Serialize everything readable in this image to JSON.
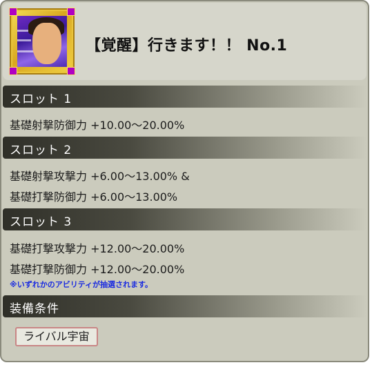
{
  "skill": {
    "title": "【覚醒】行きます！！ No.1",
    "portrait_icon": "character-portrait"
  },
  "sections": [
    {
      "label": "スロット 1",
      "lines": [
        "基礎射撃防御力 +10.00〜20.00%"
      ]
    },
    {
      "label": "スロット 2",
      "lines": [
        "基礎射撃攻撃力 +6.00〜13.00% &",
        "基礎打撃防御力 +6.00〜13.00%"
      ]
    },
    {
      "label": "スロット 3",
      "lines": [
        "基礎打撃攻撃力 +12.00〜20.00%",
        "基礎打撃防御力 +12.00〜20.00%"
      ],
      "note": "※いずれかのアビリティが抽選されます。"
    },
    {
      "label": "装備条件",
      "tag": "ライバル宇宙"
    }
  ],
  "colors": {
    "note": "#1a2be0",
    "tag_border": "#c98585",
    "bar_dark": "#2f2f28"
  }
}
